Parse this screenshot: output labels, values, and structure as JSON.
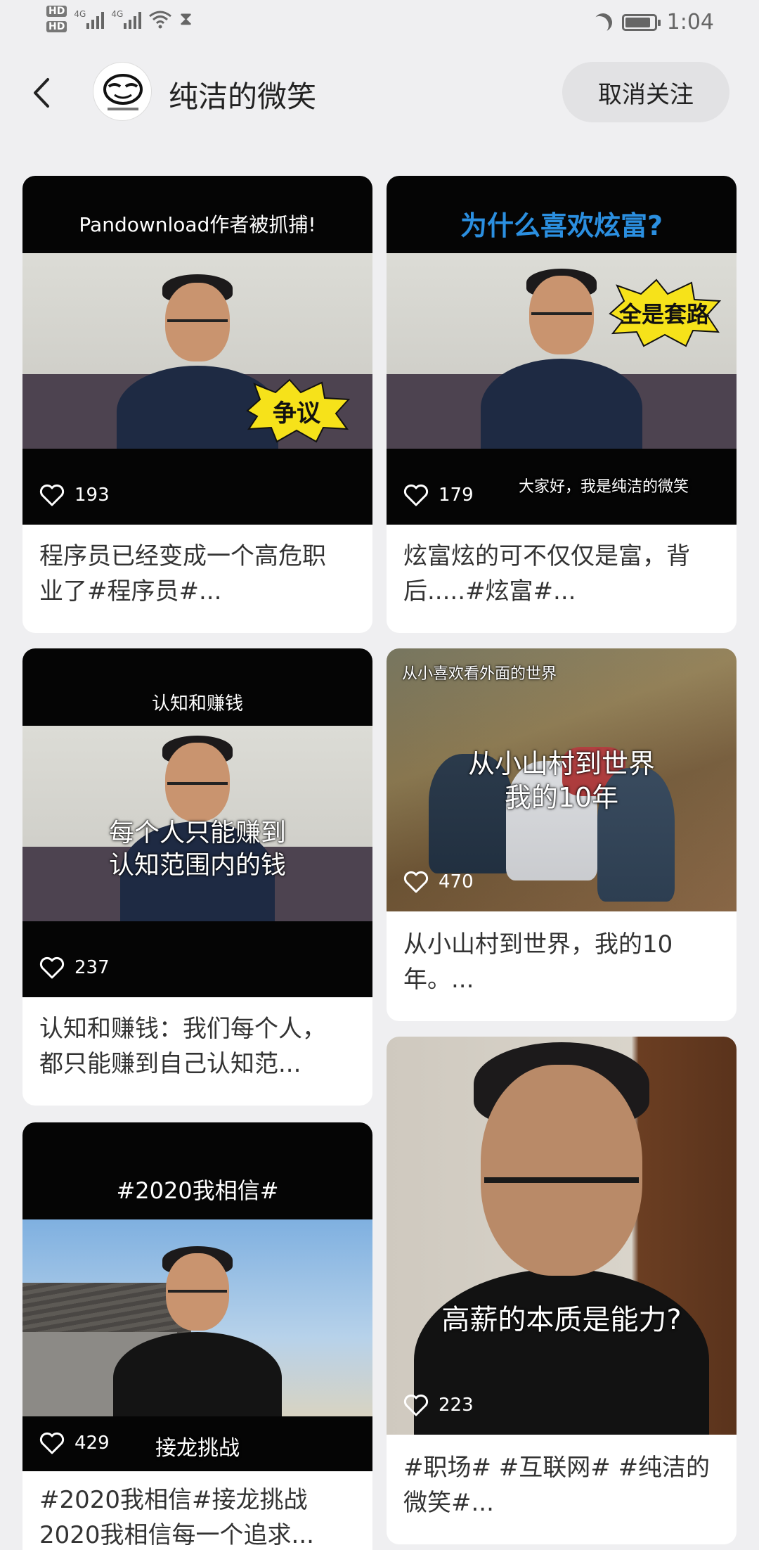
{
  "status_bar": {
    "hd1": "HD",
    "hd2": "HD",
    "net1": "4G",
    "net2": "4G",
    "time": "1:04"
  },
  "header": {
    "channel_name": "纯洁的微笑",
    "unfollow_label": "取消关注"
  },
  "cards": [
    {
      "banner": "Pandownload作者被抓捕!",
      "sticker": "争议",
      "likes": "193",
      "caption_line1": "程序员已经变成一个高危职",
      "caption_line2": "业了#程序员#..."
    },
    {
      "banner": "为什么喜欢炫富?",
      "sticker": "全是套路",
      "subtitle": "大家好，我是纯洁的微笑",
      "likes": "179",
      "caption_line1": "炫富炫的可不仅仅是富，背",
      "caption_line2": "后.....#炫富#..."
    },
    {
      "banner": "认知和赚钱",
      "overlay_line1": "每个人只能赚到",
      "overlay_line2": "认知范围内的钱",
      "likes": "237",
      "caption_line1": "认知和赚钱：我们每个人，",
      "caption_line2": "都只能赚到自己认知范..."
    },
    {
      "corner_text": "从小喜欢看外面的世界",
      "overlay_line1": "从小山村到世界",
      "overlay_line2": "我的10年",
      "likes": "470",
      "caption_line1": "从小山村到世界，我的10",
      "caption_line2": "年。..."
    },
    {
      "banner": "#2020我相信#",
      "bottom_label": "接龙挑战",
      "likes": "429",
      "caption_line1": "#2020我相信#接龙挑战",
      "caption_line2": "2020我相信每一个追求..."
    },
    {
      "overlay_line1": "高薪的本质是能力?",
      "likes": "223",
      "caption_line1": "#职场# #互联网# #纯洁的",
      "caption_line2": "微笑#..."
    }
  ],
  "colors": {
    "background": "#efeff1",
    "card": "#ffffff",
    "banner_black": "#050505",
    "banner_blue_text": "#2b8fe0",
    "sticker_yellow": "#f6e21a"
  }
}
